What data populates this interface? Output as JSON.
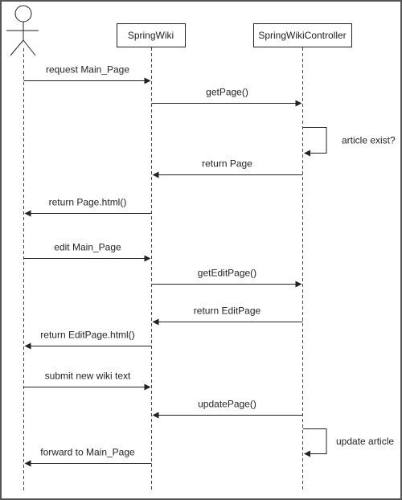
{
  "participants": [
    {
      "name": "",
      "kind": "actor"
    },
    {
      "name": "SpringWiki",
      "kind": "object"
    },
    {
      "name": "SpringWikiController",
      "kind": "object"
    }
  ],
  "messages": [
    {
      "label": "request Main_Page",
      "from": 0,
      "to": 1
    },
    {
      "label": "getPage()",
      "from": 1,
      "to": 2
    },
    {
      "label": "article exist?",
      "from": 2,
      "to": 2
    },
    {
      "label": "return Page",
      "from": 2,
      "to": 1
    },
    {
      "label": "return Page.html()",
      "from": 1,
      "to": 0
    },
    {
      "label": "edit Main_Page",
      "from": 0,
      "to": 1
    },
    {
      "label": "getEditPage()",
      "from": 1,
      "to": 2
    },
    {
      "label": "return EditPage",
      "from": 2,
      "to": 1
    },
    {
      "label": "return EditPage.html()",
      "from": 1,
      "to": 0
    },
    {
      "label": "submit new wiki text",
      "from": 0,
      "to": 1
    },
    {
      "label": "updatePage()",
      "from": 2,
      "to": 1
    },
    {
      "label": "update article",
      "from": 2,
      "to": 2
    },
    {
      "label": "forward to Main_Page",
      "from": 1,
      "to": 0
    }
  ],
  "colors": {
    "line": "#222222",
    "border": "#555555"
  }
}
